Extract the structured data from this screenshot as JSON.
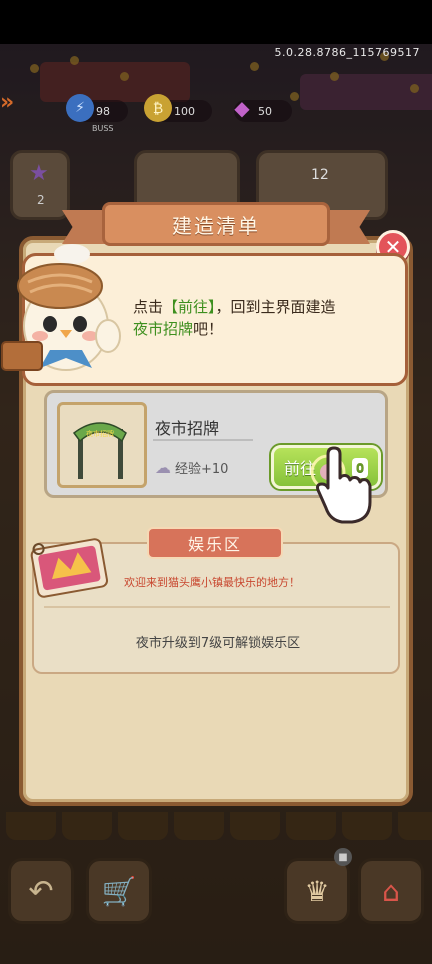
{
  "status": {
    "version": "5.0.28.8786_115769517"
  },
  "resources": [
    {
      "icon": "lightning-icon",
      "value": "98",
      "sub": "BUSS"
    },
    {
      "icon": "coin-icon",
      "value": "100"
    },
    {
      "icon": "gem-icon",
      "value": "50"
    }
  ],
  "top_cards": [
    {
      "value": "2"
    },
    {
      "value": "12"
    }
  ],
  "panel": {
    "title": "建造清单"
  },
  "tutorial": {
    "prefix": "点击",
    "action": "【前往】",
    "middle": "，回到主界面建造",
    "target": "夜市招牌",
    "suffix": "吧！"
  },
  "item": {
    "name": "夜市招牌",
    "sign_text": "夜市招牌",
    "exp_label": "经验+10",
    "go_label": "前往",
    "go_badge": "0"
  },
  "entertainment": {
    "title": "娱乐区",
    "description": "欢迎来到猫头鹰小镇最快乐的地方！",
    "lock_text": "夜市升级到7级可解锁娱乐区"
  },
  "colors": {
    "panel_bg": "#e9d9b6",
    "ribbon": "#d98f60",
    "go_button": "#86c23a",
    "close_button": "#e3545a",
    "highlight_text": "#3d8f1e",
    "ent_desc": "#c8472f"
  }
}
